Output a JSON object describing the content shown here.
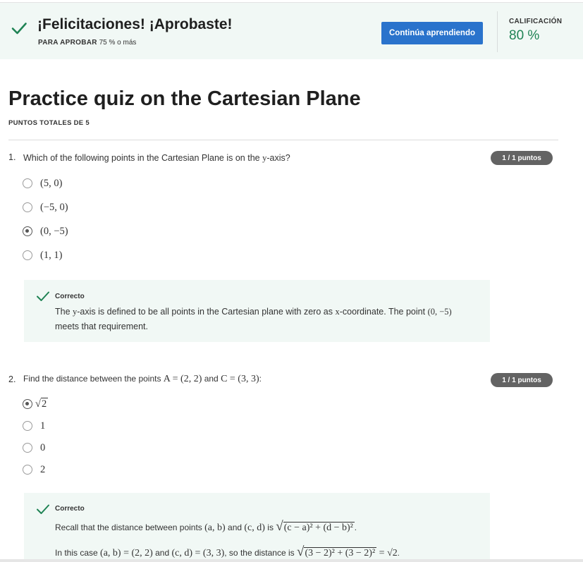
{
  "banner": {
    "title": "¡Felicitaciones! ¡Aprobaste!",
    "pass_label": "PARA APROBAR",
    "pass_value": "75 % o más",
    "continue_button": "Continúa aprendiendo",
    "grade_label": "CALIFICACIÓN",
    "grade_value": "80 %",
    "accent_green": "#1f8354",
    "button_blue": "#2a73cc"
  },
  "quiz": {
    "title": "Practice quiz on the Cartesian Plane",
    "total_points": "PUNTOS TOTALES DE 5"
  },
  "questions": [
    {
      "number": "1.",
      "text_parts": [
        "Which of the following points in the Cartesian Plane is on the ",
        "y",
        "-axis?"
      ],
      "points_badge": "1 / 1 puntos",
      "options": [
        {
          "label": "(5, 0)",
          "selected": false
        },
        {
          "label": "(−5, 0)",
          "selected": false
        },
        {
          "label": "(0, −5)",
          "selected": true
        },
        {
          "label": "(1, 1)",
          "selected": false
        }
      ],
      "feedback": {
        "status": "Correcto",
        "parts": [
          "The ",
          "y",
          "-axis is defined to be all points in the Cartesian plane with zero as ",
          "x",
          "-coordinate. The point ",
          "(0, −5)",
          " meets that requirement."
        ]
      }
    },
    {
      "number": "2.",
      "text_parts": [
        "Find the distance between the points ",
        "A = (2, 2)",
        " and ",
        "C = (3, 3)",
        ":"
      ],
      "points_badge": "1 / 1 puntos",
      "options": [
        {
          "label_prefix": "√",
          "label": "2",
          "selected": true
        },
        {
          "label": "1",
          "selected": false
        },
        {
          "label": "0",
          "selected": false
        },
        {
          "label": "2",
          "selected": false
        }
      ],
      "feedback": {
        "status": "Correcto",
        "line1": [
          "Recall that the distance between points ",
          "(a, b)",
          " and ",
          "(c, d)",
          " is ",
          "√",
          "(c − a)² + (d − b)²",
          "."
        ],
        "line2": [
          "In this case ",
          "(a, b) = (2, 2)",
          " and ",
          "(c, d) = (3, 3)",
          ", so the distance is ",
          "√",
          "(3 − 2)² + (3 − 2)²",
          " = √2",
          "."
        ]
      }
    }
  ],
  "icons": {
    "banner_check": "check-icon",
    "feedback_check": "check-icon",
    "radio": "radio-button-icon"
  }
}
